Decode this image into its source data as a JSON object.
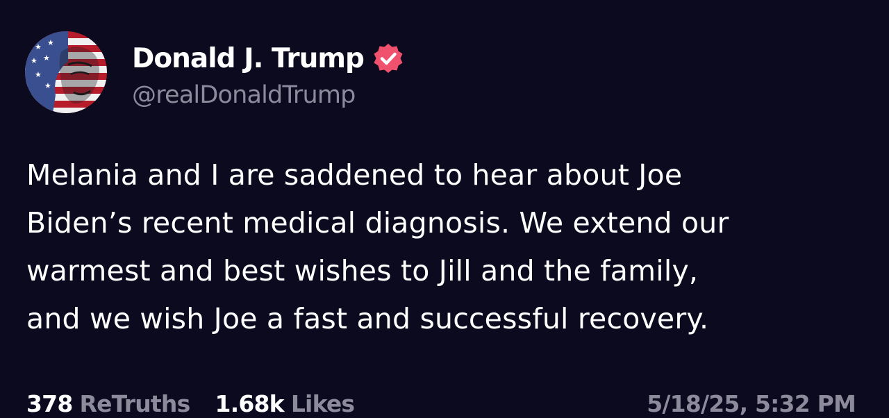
{
  "author": {
    "display_name": "Donald J. Trump",
    "handle": "@realDonaldTrump",
    "verified": true,
    "avatar_icon": "flag-portrait-avatar",
    "verified_icon": "verified-badge-icon",
    "verified_color": "#f0516d"
  },
  "post": {
    "lines": [
      "Melania and I are saddened to hear about Joe",
      "Biden’s recent medical diagnosis. We extend our",
      "warmest and best wishes to Jill and the family,",
      "and we wish Joe a fast and successful recovery."
    ]
  },
  "stats": {
    "retruths_count": "378",
    "retruths_label": "ReTruths",
    "likes_count": "1.68k",
    "likes_label": "Likes"
  },
  "timestamp": "5/18/25, 5:32 PM",
  "colors": {
    "background": "#0c0a1f",
    "primary_text": "#ffffff",
    "secondary_text": "#8d8a9b"
  }
}
